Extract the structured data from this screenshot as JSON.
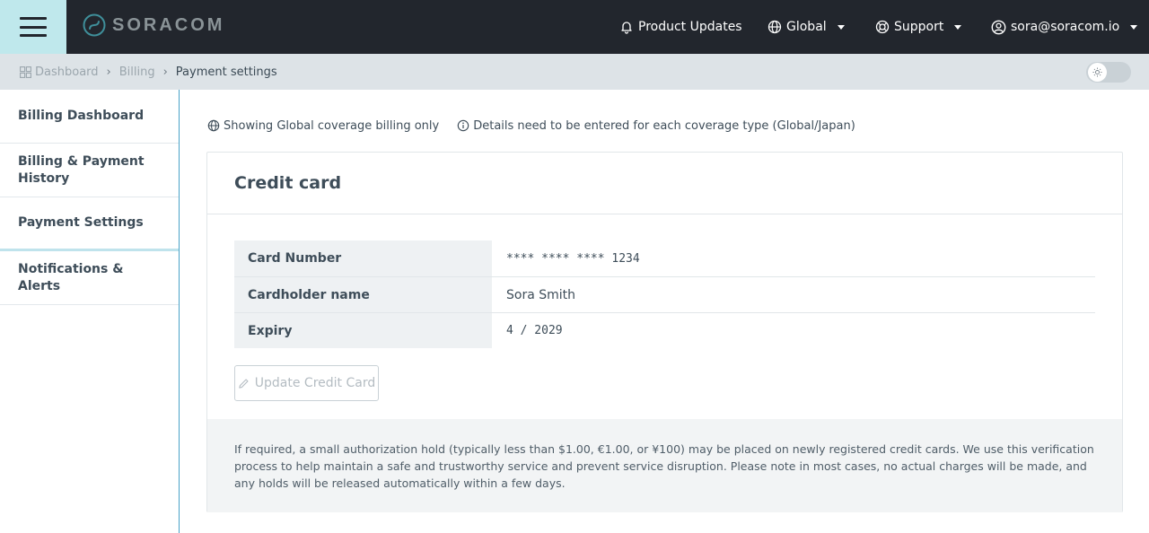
{
  "header": {
    "brand": "SORACOM",
    "product_updates": "Product Updates",
    "region": "Global",
    "support": "Support",
    "account": "sora@soracom.io",
    "icons": {
      "menu": "hamburger-icon",
      "bell": "bell-icon",
      "globe": "globe-icon",
      "support": "lifebuoy-icon",
      "user": "user-icon"
    }
  },
  "breadcrumb": {
    "items": [
      "Dashboard",
      "Billing",
      "Payment settings"
    ]
  },
  "sidebar": {
    "items": [
      {
        "label": "Billing Dashboard"
      },
      {
        "label": "Billing & Payment History"
      },
      {
        "label": "Payment Settings"
      },
      {
        "label": "Notifications & Alerts"
      }
    ],
    "active": "Payment Settings"
  },
  "main": {
    "coverage_note": "Showing Global coverage billing only",
    "details_note": "Details need to be entered for each coverage type (Global/Japan)",
    "card": {
      "title": "Credit card",
      "rows": [
        {
          "label": "Card Number",
          "value": "**** **** **** 1234"
        },
        {
          "label": "Cardholder name",
          "value": "Sora Smith"
        },
        {
          "label": "Expiry",
          "value": "4 / 2029"
        }
      ],
      "update_button": "Update Credit Card",
      "notice": "If required, a small authorization hold (typically less than $1.00, €1.00, or ¥100) may be placed on newly registered credit cards. We use this verification process to help maintain a safe and trustworthy service and prevent service disruption. Please note in most cases, no actual charges will be made, and any holds will be released automatically within a few days."
    }
  },
  "colors": {
    "topbar": "#22262d",
    "menu_accent": "#bfe8ec",
    "sidebar_border": "#4aa3c8"
  }
}
